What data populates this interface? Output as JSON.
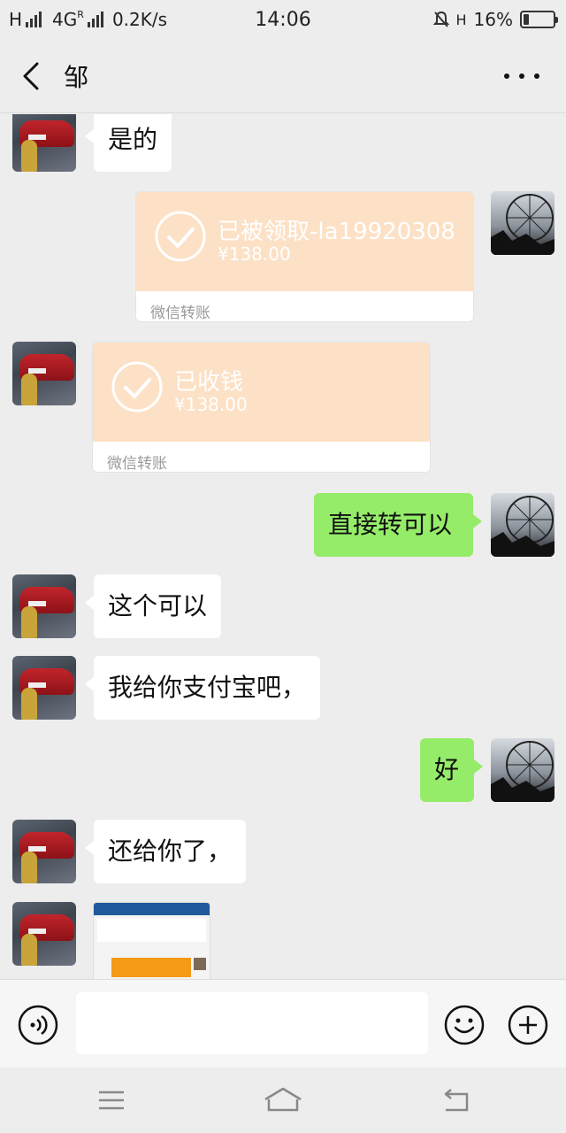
{
  "status_bar": {
    "carrier1": "H",
    "carrier2": "4G",
    "roaming": "R",
    "speed": "0.2K/s",
    "time": "14:06",
    "hd": "H",
    "battery": "16%",
    "battery_level": 0.16
  },
  "header": {
    "title": "邹",
    "back_icon": "chevron-left-icon",
    "more_icon": "more-horizontal-icon"
  },
  "messages": [
    {
      "id": "m1",
      "side": "left",
      "type": "text",
      "text": "是的"
    },
    {
      "id": "m2",
      "side": "right",
      "type": "transfer",
      "status": "已被领取-la19920308",
      "amount": "¥138.00",
      "label": "微信转账"
    },
    {
      "id": "m3",
      "side": "left",
      "type": "transfer",
      "status": "已收钱",
      "amount": "¥138.00",
      "label": "微信转账"
    },
    {
      "id": "m4",
      "side": "right",
      "type": "text",
      "text": "直接转可以"
    },
    {
      "id": "m5",
      "side": "left",
      "type": "text",
      "text": "这个可以"
    },
    {
      "id": "m6",
      "side": "left",
      "type": "text",
      "text": "我给你支付宝吧，"
    },
    {
      "id": "m7",
      "side": "right",
      "type": "text",
      "text": "好"
    },
    {
      "id": "m8",
      "side": "left",
      "type": "text",
      "text": "还给你了，"
    },
    {
      "id": "m9",
      "side": "left",
      "type": "image"
    }
  ],
  "input_bar": {
    "voice_icon": "voice-icon",
    "emoji_icon": "emoji-icon",
    "plus_icon": "plus-icon",
    "placeholder": ""
  },
  "nav_bar": {
    "menu_icon": "menu-icon",
    "home_icon": "home-icon",
    "back_icon": "back-icon"
  },
  "colors": {
    "background": "#ededed",
    "sent_bubble": "#95ec69",
    "received_bubble": "#ffffff",
    "transfer_card": "#fce1c6"
  }
}
